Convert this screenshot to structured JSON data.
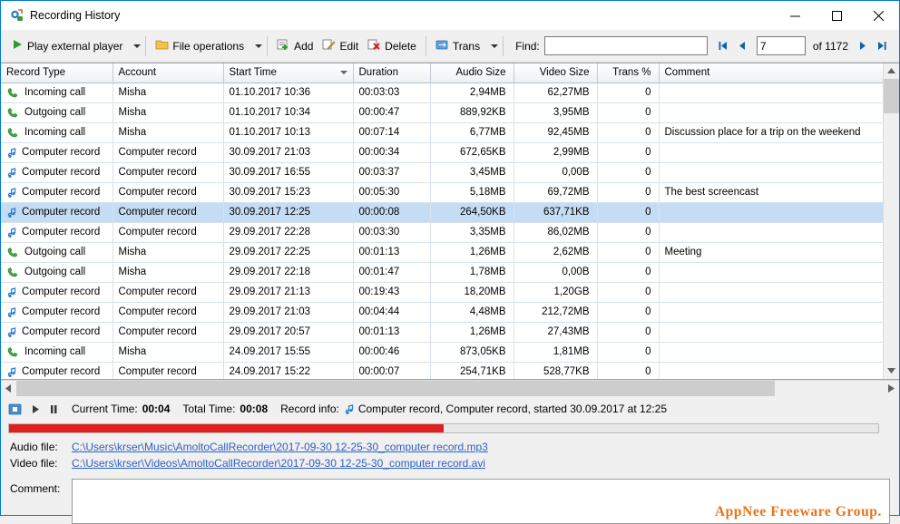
{
  "window": {
    "title": "Recording History",
    "minimize": "—",
    "maximize": "□",
    "close": "✕"
  },
  "toolbar": {
    "play_external": "Play external player",
    "file_operations": "File operations",
    "add": "Add",
    "edit": "Edit",
    "delete": "Delete",
    "trans": "Trans",
    "find_label": "Find:",
    "find_value": "",
    "find_placeholder": "",
    "page_value": "7",
    "of_text": "of 1172",
    "first_icon": "⏮",
    "prev_icon": "◀",
    "next_icon": "▶",
    "last_icon": "⏭"
  },
  "grid": {
    "columns": [
      {
        "label": "Record Type",
        "align": "left"
      },
      {
        "label": "Account",
        "align": "left"
      },
      {
        "label": "Start Time",
        "align": "left",
        "sorted": true
      },
      {
        "label": "Duration",
        "align": "left"
      },
      {
        "label": "Audio Size",
        "align": "right"
      },
      {
        "label": "Video Size",
        "align": "right"
      },
      {
        "label": "Trans %",
        "align": "right"
      },
      {
        "label": "Comment",
        "align": "left"
      }
    ],
    "rows": [
      {
        "icon": "incoming-call",
        "type": "Incoming call",
        "account": "Misha",
        "start": "01.10.2017 10:36",
        "duration": "00:03:03",
        "audio": "2,94MB",
        "video": "62,27MB",
        "trans": "0",
        "comment": "",
        "selected": false
      },
      {
        "icon": "outgoing-call",
        "type": "Outgoing call",
        "account": "Misha",
        "start": "01.10.2017 10:34",
        "duration": "00:00:47",
        "audio": "889,92KB",
        "video": "3,95MB",
        "trans": "0",
        "comment": "",
        "selected": false
      },
      {
        "icon": "incoming-call",
        "type": "Incoming call",
        "account": "Misha",
        "start": "01.10.2017 10:13",
        "duration": "00:07:14",
        "audio": "6,77MB",
        "video": "92,45MB",
        "trans": "0",
        "comment": "Discussion place for a trip on the weekend",
        "selected": false
      },
      {
        "icon": "computer-record",
        "type": "Computer record",
        "account": "Computer record",
        "start": "30.09.2017 21:03",
        "duration": "00:00:34",
        "audio": "672,65KB",
        "video": "2,99MB",
        "trans": "0",
        "comment": "",
        "selected": false
      },
      {
        "icon": "computer-record",
        "type": "Computer record",
        "account": "Computer record",
        "start": "30.09.2017 16:55",
        "duration": "00:03:37",
        "audio": "3,45MB",
        "video": "0,00B",
        "trans": "0",
        "comment": "",
        "selected": false
      },
      {
        "icon": "computer-record",
        "type": "Computer record",
        "account": "Computer record",
        "start": "30.09.2017 15:23",
        "duration": "00:05:30",
        "audio": "5,18MB",
        "video": "69,72MB",
        "trans": "0",
        "comment": "The best screencast",
        "selected": false
      },
      {
        "icon": "computer-record",
        "type": "Computer record",
        "account": "Computer record",
        "start": "30.09.2017 12:25",
        "duration": "00:00:08",
        "audio": "264,50KB",
        "video": "637,71KB",
        "trans": "0",
        "comment": "",
        "selected": true
      },
      {
        "icon": "computer-record",
        "type": "Computer record",
        "account": "Computer record",
        "start": "29.09.2017 22:28",
        "duration": "00:03:30",
        "audio": "3,35MB",
        "video": "86,02MB",
        "trans": "0",
        "comment": "",
        "selected": false
      },
      {
        "icon": "outgoing-call",
        "type": "Outgoing call",
        "account": "Misha",
        "start": "29.09.2017 22:25",
        "duration": "00:01:13",
        "audio": "1,26MB",
        "video": "2,62MB",
        "trans": "0",
        "comment": "Meeting",
        "selected": false
      },
      {
        "icon": "outgoing-call",
        "type": "Outgoing call",
        "account": "Misha",
        "start": "29.09.2017 22:18",
        "duration": "00:01:47",
        "audio": "1,78MB",
        "video": "0,00B",
        "trans": "0",
        "comment": "",
        "selected": false
      },
      {
        "icon": "computer-record",
        "type": "Computer record",
        "account": "Computer record",
        "start": "29.09.2017 21:13",
        "duration": "00:19:43",
        "audio": "18,20MB",
        "video": "1,20GB",
        "trans": "0",
        "comment": "",
        "selected": false
      },
      {
        "icon": "computer-record",
        "type": "Computer record",
        "account": "Computer record",
        "start": "29.09.2017 21:03",
        "duration": "00:04:44",
        "audio": "4,48MB",
        "video": "212,72MB",
        "trans": "0",
        "comment": "",
        "selected": false
      },
      {
        "icon": "computer-record",
        "type": "Computer record",
        "account": "Computer record",
        "start": "29.09.2017 20:57",
        "duration": "00:01:13",
        "audio": "1,26MB",
        "video": "27,43MB",
        "trans": "0",
        "comment": "",
        "selected": false
      },
      {
        "icon": "incoming-call",
        "type": "Incoming call",
        "account": "Misha",
        "start": "24.09.2017 15:55",
        "duration": "00:00:46",
        "audio": "873,05KB",
        "video": "1,81MB",
        "trans": "0",
        "comment": "",
        "selected": false
      },
      {
        "icon": "computer-record",
        "type": "Computer record",
        "account": "Computer record",
        "start": "24.09.2017 15:22",
        "duration": "00:00:07",
        "audio": "254,71KB",
        "video": "528,77KB",
        "trans": "0",
        "comment": "",
        "selected": false
      }
    ]
  },
  "player": {
    "current_time_label": "Current Time:",
    "current_time": "00:04",
    "total_time_label": "Total Time:",
    "total_time": "00:08",
    "record_info_label": "Record info:",
    "record_info": "Computer record,  Computer record,  started 30.09.2017 at 12:25",
    "progress_percent": 50
  },
  "files": {
    "audio_label": "Audio file:",
    "audio_path": "C:\\Users\\krser\\Music\\AmoltoCallRecorder\\2017-09-30 12-25-30_computer record.mp3",
    "video_label": "Video file:",
    "video_path": "C:\\Users\\krser\\Videos\\AmoltoCallRecorder\\2017-09-30 12-25-30_computer record.avi",
    "comment_label": "Comment:",
    "comment_value": ""
  },
  "watermark": "AppNee Freeware Group.",
  "colors": {
    "accent": "#0078d7",
    "link": "#2f5fc4",
    "progress": "#e02020",
    "selection": "#c5dcf5",
    "watermark": "#e8731a"
  }
}
